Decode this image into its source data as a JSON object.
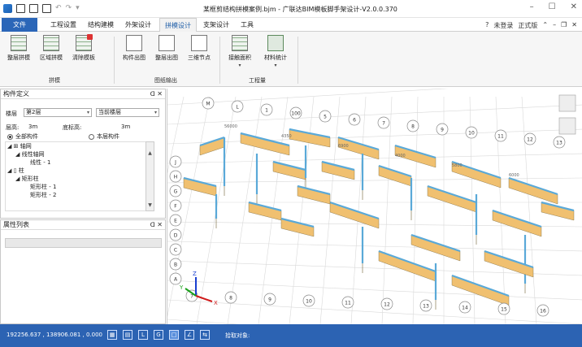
{
  "window": {
    "title": "某框剪结构拼模案例.bjm - 广联达BIM模板脚手架设计-V2.0.0.370",
    "controls": [
      "–",
      "☐",
      "✕"
    ]
  },
  "menu": {
    "file": "文件",
    "tabs": [
      "工程设置",
      "结构建模",
      "外架设计",
      "拼模设计",
      "支架设计",
      "工具"
    ],
    "active_tab": "拼模设计",
    "right": {
      "help": "?",
      "login": "未登录",
      "edition": "正式版"
    }
  },
  "ribbon": {
    "buttons": [
      {
        "label": "整层拼模",
        "icon": "floor-tile-icon"
      },
      {
        "label": "区域拼模",
        "icon": "area-tile-icon"
      },
      {
        "label": "清除模板",
        "icon": "clear-template-icon"
      },
      {
        "label": "构件出图",
        "icon": "component-drawing-icon"
      },
      {
        "label": "整层出图",
        "icon": "floor-drawing-icon"
      },
      {
        "label": "三维节点",
        "icon": "3d-node-icon"
      },
      {
        "label": "接触面积",
        "icon": "contact-area-icon"
      },
      {
        "label": "材料统计",
        "icon": "material-stats-icon"
      }
    ],
    "groups": [
      "拼模",
      "图纸输出",
      "工程量"
    ]
  },
  "component_panel": {
    "title": "构件定义",
    "floor_label": "楼层",
    "floor_value": "第2层",
    "floor_scope": "当前楼层",
    "height_label": "层高:",
    "height_value": "3m",
    "base_label": "底标高:",
    "base_value": "3m",
    "radio_all": "全部构件",
    "radio_floor": "本层构件",
    "tree": [
      {
        "level": 0,
        "text": "轴网"
      },
      {
        "level": 1,
        "text": "线性轴网"
      },
      {
        "level": 2,
        "text": "线性 - 1"
      },
      {
        "level": 0,
        "text": "柱"
      },
      {
        "level": 1,
        "text": "矩形柱"
      },
      {
        "level": 2,
        "text": "矩形柱 - 1"
      },
      {
        "level": 2,
        "text": "矩形柱 - 2"
      }
    ]
  },
  "property_panel": {
    "title": "属性列表"
  },
  "viewport": {
    "axis_labels_top": [
      "M",
      "L",
      "1",
      "100",
      "5",
      "6",
      "7",
      "8",
      "9",
      "10",
      "11",
      "12",
      "13"
    ],
    "axis_labels_left": [
      "J",
      "H",
      "G",
      "F",
      "E",
      "D",
      "C",
      "B",
      "A",
      "7",
      "8",
      "9",
      "10",
      "11",
      "12",
      "13",
      "14",
      "15",
      "16"
    ],
    "dim_labels": [
      "56000",
      "4350",
      "6900",
      "4000",
      "5800",
      "6000"
    ],
    "axes": {
      "x": "X",
      "y": "Y",
      "z": "Z"
    }
  },
  "status": {
    "coordinates": "192256.637 , 138906.081 , 0.000",
    "pick_label": "拾取对象:"
  },
  "colors": {
    "file_tab": "#2b66b8",
    "statusbar": "#2c63b3",
    "wall_face": "#f0c070",
    "wall_top": "#5aa9d8"
  }
}
